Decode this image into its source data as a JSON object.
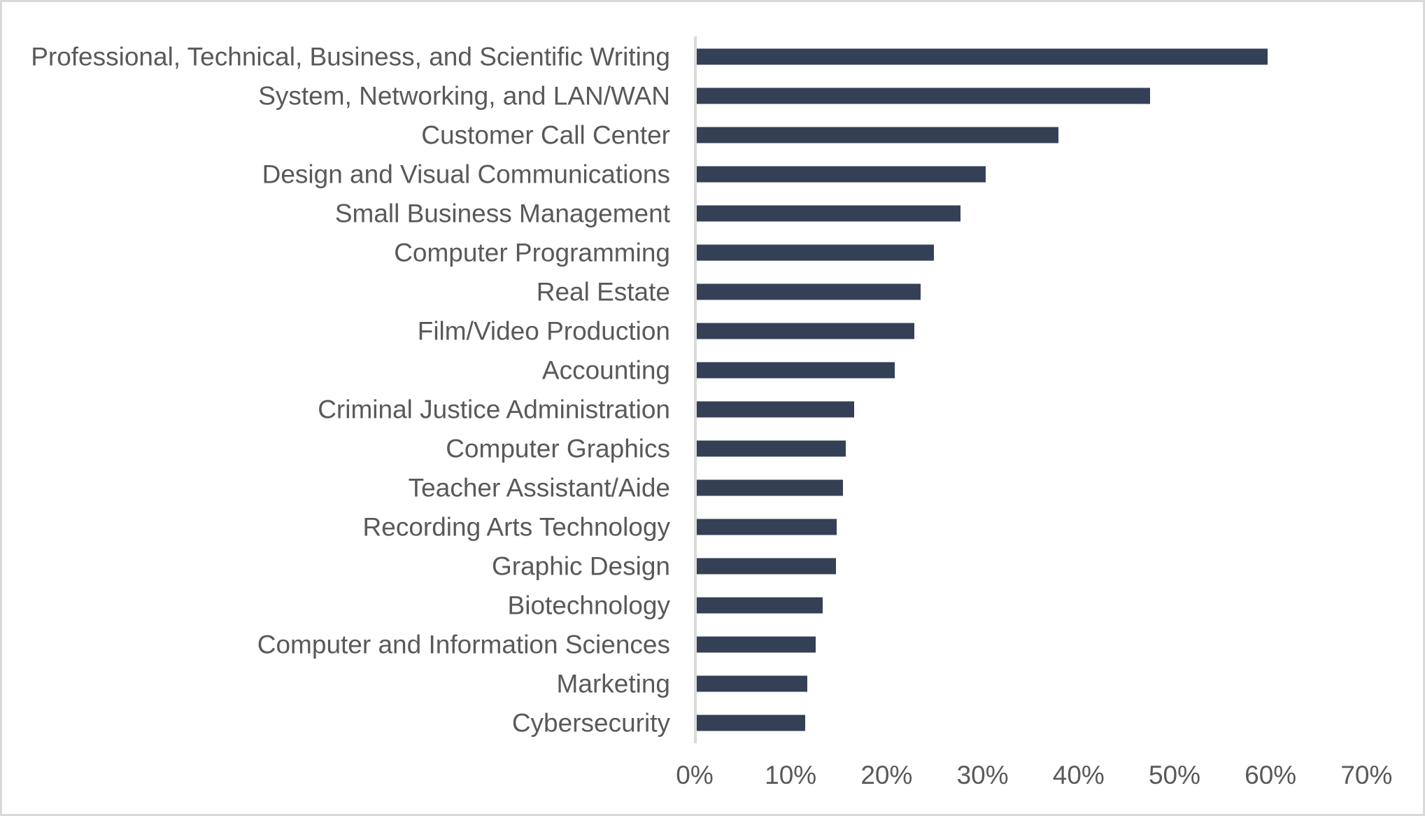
{
  "chart_data": {
    "type": "bar",
    "orientation": "horizontal",
    "title": "",
    "subtitle": "",
    "xlabel": "",
    "ylabel": "",
    "xlim": [
      0,
      70
    ],
    "xtick_labels": [
      "0%",
      "10%",
      "20%",
      "30%",
      "40%",
      "50%",
      "60%",
      "70%"
    ],
    "xtick_values": [
      0,
      10,
      20,
      30,
      40,
      50,
      60,
      70
    ],
    "grid": false,
    "legend": null,
    "value_suffix": "%",
    "bar_color": "#344055",
    "axis_color": "#d9d9d9",
    "label_color": "#595959",
    "border_color": "#d9d9d9",
    "background": "#ffffff",
    "categories": [
      "Professional, Technical, Business, and Scientific Writing",
      "System, Networking, and LAN/WAN",
      "Customer Call Center",
      "Design and Visual Communications",
      "Small Business Management",
      "Computer Programming",
      "Real Estate",
      "Film/Video Production",
      "Accounting",
      "Criminal Justice Administration",
      "Computer Graphics",
      "Teacher Assistant/Aide",
      "Recording Arts Technology",
      "Graphic Design",
      "Biotechnology",
      "Computer and Information Sciences",
      "Marketing",
      "Cybersecurity"
    ],
    "values": [
      59.5,
      47.2,
      37.7,
      30.1,
      27.5,
      24.7,
      23.3,
      22.7,
      20.6,
      16.4,
      15.5,
      15.2,
      14.6,
      14.5,
      13.1,
      12.4,
      11.5,
      11.3
    ]
  }
}
